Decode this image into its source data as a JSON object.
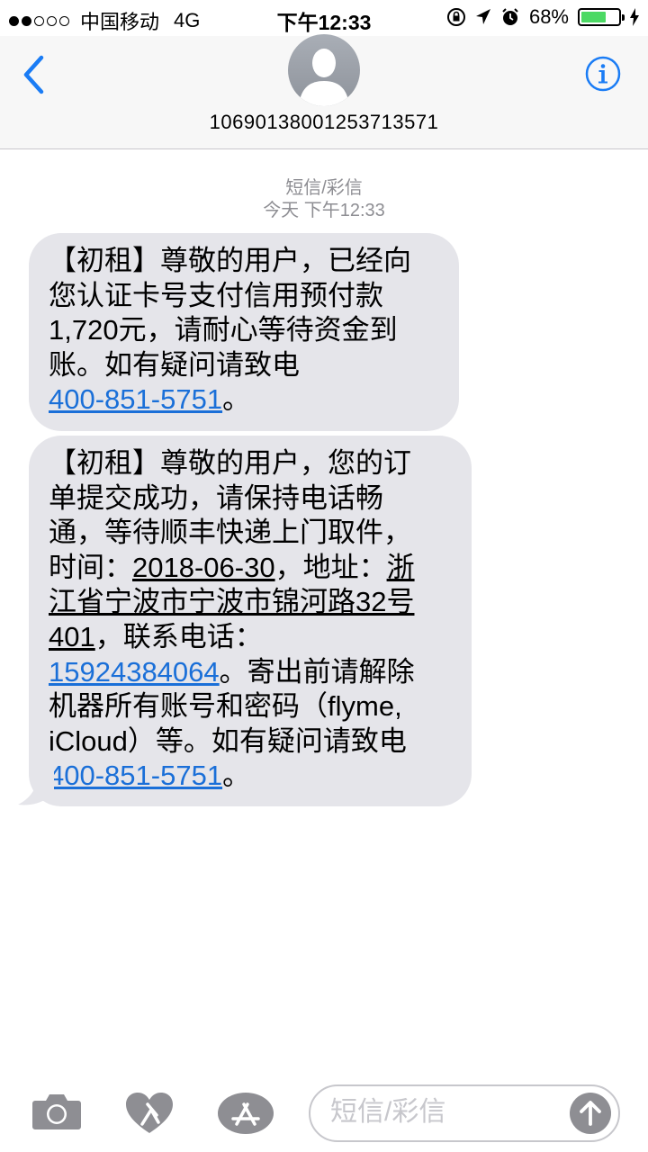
{
  "status_bar": {
    "carrier": "中国移动",
    "network": "4G",
    "time": "下午12:33",
    "battery_text": "68%",
    "battery_level": 0.68
  },
  "header": {
    "contact_number": "10690138001253713571",
    "back_icon": "chevron-left-icon",
    "info_icon": "info-icon"
  },
  "conversation": {
    "message_type": "短信/彩信",
    "timestamp": "今天 下午12:33",
    "messages": [
      {
        "lines": [
          "【初租】尊敬的用户，已经向",
          "您认证卡号支付信用预付款",
          "1,720元，请耐心等待资金到",
          "账。如有疑问请致电"
        ],
        "phone": "400-851-5751",
        "end": "。"
      },
      {
        "lines": [
          "【初租】尊敬的用户，您的订",
          "单提交成功，请保持电话畅",
          "通，等待顺丰快递上门取件，"
        ],
        "time_prefix": "时间：",
        "date": "2018-06-30",
        "address_label": "，地址：",
        "address_first": "浙",
        "address_line": "江省宁波市宁波市锦河路32号",
        "address_end": "401",
        "contact_label": "，联系电话：",
        "phone_mobile": "15924384064",
        "mobile_after": "。寄出前请解除",
        "line_8": "机器所有账号和密码（flyme,",
        "line_9": "iCloud）等。如有疑问请致电",
        "phone": "400-851-5751",
        "end": "。"
      }
    ]
  },
  "input": {
    "placeholder": "短信/彩信"
  },
  "colors": {
    "link": "#1a6fd8",
    "bubble": "#e5e5ea",
    "accent": "#1a7cf5",
    "battery": "#4cd964"
  }
}
